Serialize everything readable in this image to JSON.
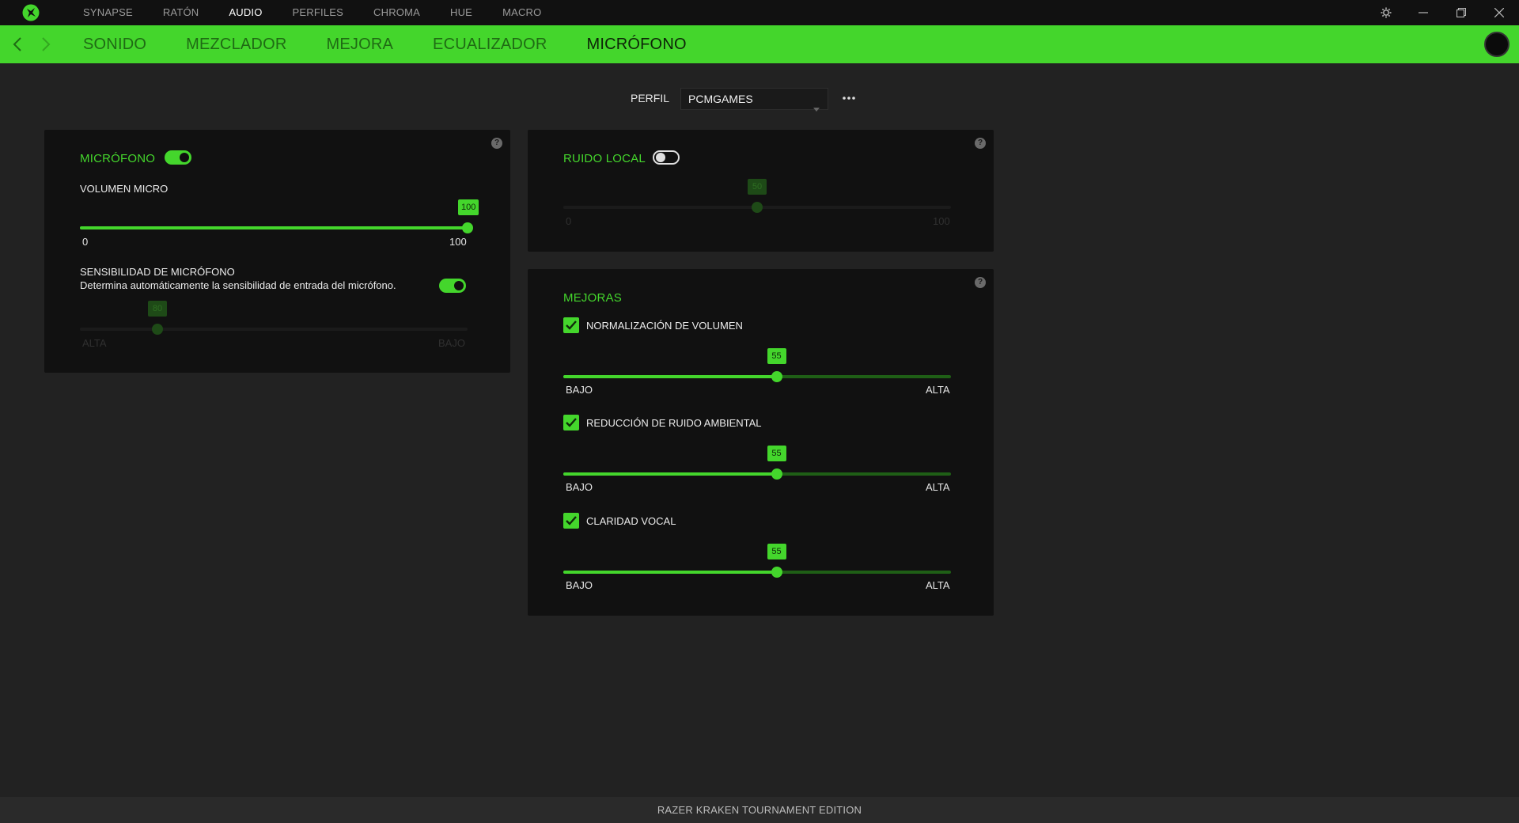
{
  "topnav": {
    "items": [
      {
        "label": "SYNAPSE"
      },
      {
        "label": "RATÓN"
      },
      {
        "label": "AUDIO"
      },
      {
        "label": "PERFILES"
      },
      {
        "label": "CHROMA"
      },
      {
        "label": "HUE"
      },
      {
        "label": "MACRO"
      }
    ],
    "active_index": 2
  },
  "subnav": {
    "tabs": [
      {
        "label": "SONIDO"
      },
      {
        "label": "MEZCLADOR"
      },
      {
        "label": "MEJORA"
      },
      {
        "label": "ECUALIZADOR"
      },
      {
        "label": "MICRÓFONO"
      }
    ],
    "active_index": 4
  },
  "profile": {
    "label": "PERFIL",
    "selected": "PCMGAMES"
  },
  "microphone_panel": {
    "title": "MICRÓFONO",
    "enabled": true,
    "volume": {
      "label": "VOLUMEN MICRO",
      "value": 100,
      "value_text": "100",
      "min_label": "0",
      "max_label": "100"
    },
    "sensitivity": {
      "title": "SENSIBILIDAD DE MICRÓFONO",
      "description": "Determina automáticamente la sensibilidad de entrada del micrófono.",
      "auto_enabled": true,
      "value": 80,
      "value_text": "80",
      "min_label": "ALTA",
      "max_label": "BAJO"
    }
  },
  "side_tone_panel": {
    "title": "RUIDO LOCAL",
    "enabled": false,
    "value": 50,
    "value_text": "50",
    "min_label": "0",
    "max_label": "100"
  },
  "enhancements_panel": {
    "title": "MEJORAS",
    "items": [
      {
        "label": "NORMALIZACIÓN DE VOLUMEN",
        "checked": true,
        "value": 55,
        "value_text": "55",
        "min_label": "BAJO",
        "max_label": "ALTA"
      },
      {
        "label": "REDUCCIÓN DE RUIDO AMBIENTAL",
        "checked": true,
        "value": 55,
        "value_text": "55",
        "min_label": "BAJO",
        "max_label": "ALTA"
      },
      {
        "label": "CLARIDAD VOCAL",
        "checked": true,
        "value": 55,
        "value_text": "55",
        "min_label": "BAJO",
        "max_label": "ALTA"
      }
    ]
  },
  "footer": {
    "device_name": "RAZER KRAKEN TOURNAMENT EDITION"
  },
  "colors": {
    "accent": "#44d62c",
    "background": "#222222",
    "panel": "#111111",
    "titlebar": "#111111"
  }
}
